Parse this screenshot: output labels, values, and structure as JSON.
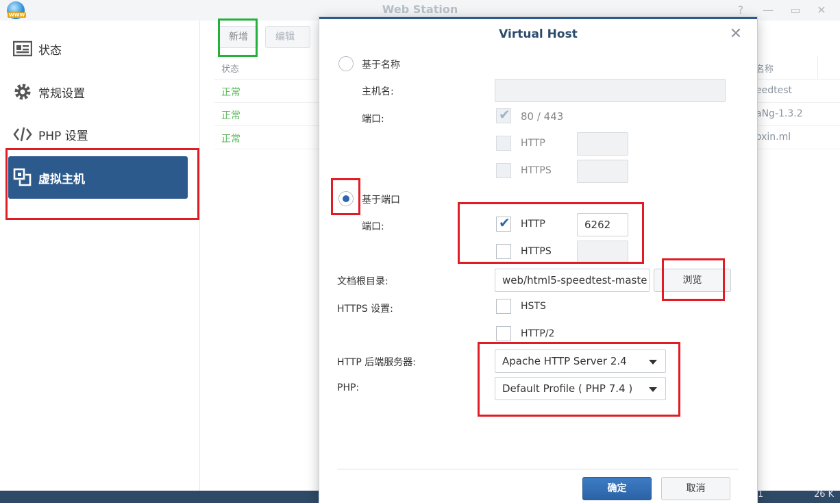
{
  "window": {
    "title": "Web Station",
    "controls": {
      "help": "?",
      "minimize": "—",
      "maximize": "▭",
      "close": "✕"
    }
  },
  "sidebar": {
    "items": [
      {
        "label": "状态",
        "icon": "status-card-icon",
        "active": false
      },
      {
        "label": "常规设置",
        "icon": "gear-icon",
        "active": false
      },
      {
        "label": "PHP 设置",
        "icon": "code-icon",
        "active": false
      },
      {
        "label": "虚拟主机",
        "icon": "virtual-host-icon",
        "active": true
      }
    ]
  },
  "toolbar": {
    "add_label": "新增",
    "edit_label": "编辑"
  },
  "table": {
    "columns": {
      "status": "状态",
      "name": "名称"
    },
    "rows": [
      {
        "status": "正常",
        "name": "eedtest"
      },
      {
        "status": "正常",
        "name": "aNg-1.3.2"
      },
      {
        "status": "正常",
        "name": "oxin.ml"
      }
    ]
  },
  "bottom": {
    "left_text": "1",
    "right_text": "26 K"
  },
  "dialog": {
    "title": "Virtual Host",
    "close": "✕",
    "by_name": {
      "label": "基于名称",
      "hostname_label": "主机名:",
      "hostname_value": "",
      "port_label": "端口:",
      "port_default_label": "80 / 443",
      "http_label": "HTTP",
      "https_label": "HTTPS",
      "http_port": "",
      "https_port": ""
    },
    "by_port": {
      "label": "基于端口",
      "port_label": "端口:",
      "http_label": "HTTP",
      "http_port": "6262",
      "https_label": "HTTPS",
      "https_port": ""
    },
    "docroot": {
      "label": "文档根目录:",
      "value": "web/html5-speedtest-maste",
      "browse_label": "浏览"
    },
    "https": {
      "label": "HTTPS 设置:",
      "hsts_label": "HSTS",
      "http2_label": "HTTP/2"
    },
    "backend": {
      "label": "HTTP 后端服务器:",
      "value": "Apache HTTP Server 2.4"
    },
    "php": {
      "label": "PHP:",
      "value": "Default Profile ( PHP 7.4 )"
    },
    "ok_label": "确定",
    "cancel_label": "取消"
  }
}
